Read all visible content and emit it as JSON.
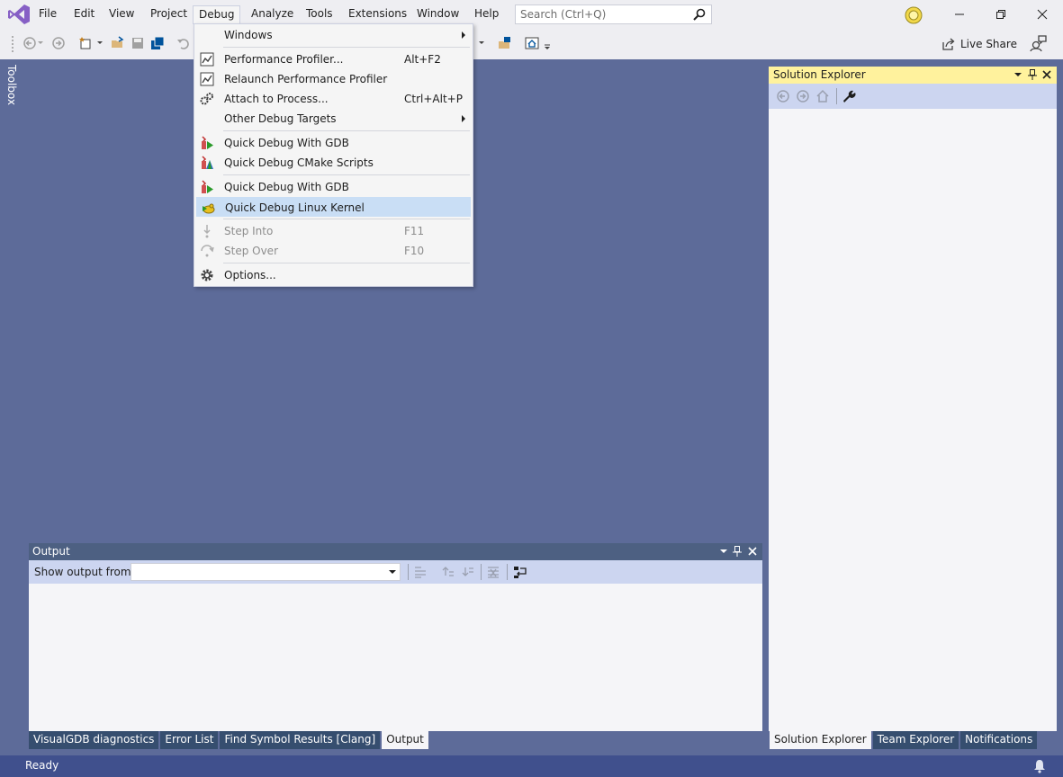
{
  "menubar": {
    "items": [
      "File",
      "Edit",
      "View",
      "Project",
      "Debug",
      "Analyze",
      "Tools",
      "Extensions",
      "Window",
      "Help"
    ],
    "search_placeholder": "Search (Ctrl+Q)"
  },
  "toolbar": {
    "live_share": "Live Share"
  },
  "toolbox": {
    "label": "Toolbox"
  },
  "debug_menu": {
    "items": [
      {
        "label": "Windows",
        "shortcut": ""
      },
      {
        "label": "Performance Profiler...",
        "shortcut": "Alt+F2"
      },
      {
        "label": "Relaunch Performance Profiler",
        "shortcut": ""
      },
      {
        "label": "Attach to Process...",
        "shortcut": "Ctrl+Alt+P"
      },
      {
        "label": "Other Debug Targets",
        "shortcut": ""
      },
      {
        "label": "Quick Debug With GDB",
        "shortcut": ""
      },
      {
        "label": "Quick Debug CMake Scripts",
        "shortcut": ""
      },
      {
        "label": "Quick Debug With GDB",
        "shortcut": ""
      },
      {
        "label": "Quick Debug Linux Kernel",
        "shortcut": ""
      },
      {
        "label": "Step Into",
        "shortcut": "F11"
      },
      {
        "label": "Step Over",
        "shortcut": "F10"
      },
      {
        "label": "Options...",
        "shortcut": ""
      }
    ]
  },
  "solution_explorer": {
    "title": "Solution Explorer"
  },
  "output": {
    "title": "Output",
    "show_output_from": "Show output from:"
  },
  "bottom_tabs_left": [
    "VisualGDB diagnostics",
    "Error List",
    "Find Symbol Results [Clang]",
    "Output"
  ],
  "bottom_tabs_right": [
    "Solution Explorer",
    "Team Explorer",
    "Notifications"
  ],
  "status": {
    "text": "Ready"
  },
  "colors": {
    "workspace": "#5d6b99",
    "chrome": "#eeeef2",
    "solution_explorer_header": "#fff29d",
    "output_header": "#4d6082",
    "status_bar": "#40508d",
    "menu_highlight": "#c9def5"
  }
}
